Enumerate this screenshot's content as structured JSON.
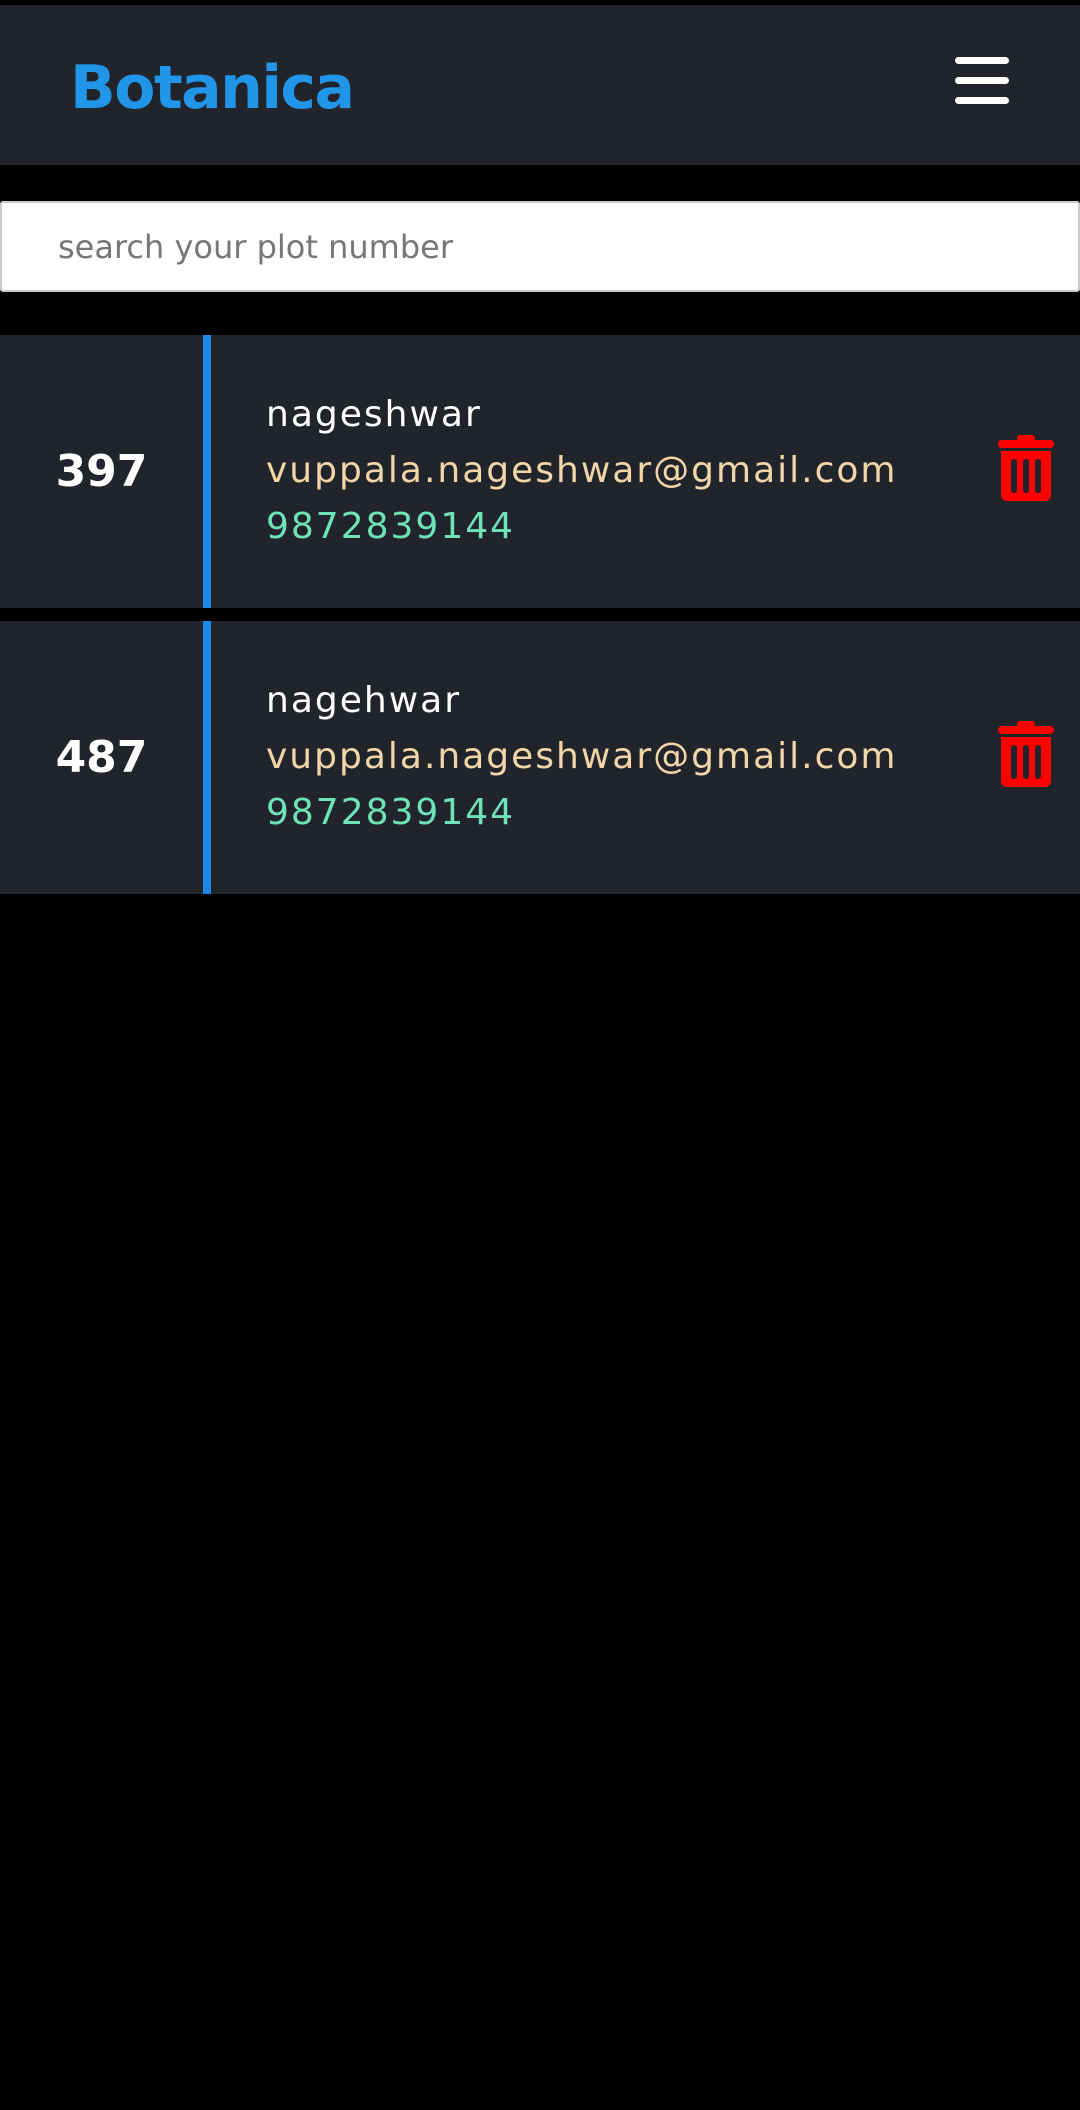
{
  "header": {
    "brand": "Botanica"
  },
  "search": {
    "placeholder": "search your plot number",
    "value": ""
  },
  "plots": [
    {
      "plot_number": "397",
      "name": "nageshwar",
      "email": "vuppala.nageshwar@gmail.com",
      "phone": "9872839144"
    },
    {
      "plot_number": "487",
      "name": "nagehwar",
      "email": "vuppala.nageshwar@gmail.com",
      "phone": "9872839144"
    }
  ],
  "icons": {
    "menu": "hamburger-menu-icon",
    "delete": "trash-icon"
  },
  "colors": {
    "brand": "#2196e8",
    "accent": "#1e88e5",
    "card_bg": "#22242c",
    "email": "#f1d6a8",
    "phone": "#6fe3b8",
    "delete": "#ff0000"
  }
}
